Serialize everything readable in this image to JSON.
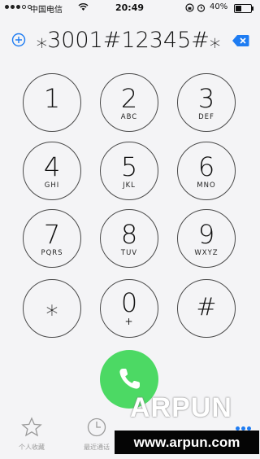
{
  "status_bar": {
    "carrier": "中国电信",
    "time": "20:49",
    "battery_percent": "40%",
    "battery_level": 0.4,
    "signal_strength": 3
  },
  "dialer": {
    "number": "⁎3001#12345#⁎"
  },
  "keypad": [
    {
      "digit": "1",
      "letters": ""
    },
    {
      "digit": "2",
      "letters": "ABC"
    },
    {
      "digit": "3",
      "letters": "DEF"
    },
    {
      "digit": "4",
      "letters": "GHI"
    },
    {
      "digit": "5",
      "letters": "JKL"
    },
    {
      "digit": "6",
      "letters": "MNO"
    },
    {
      "digit": "7",
      "letters": "PQRS"
    },
    {
      "digit": "8",
      "letters": "TUV"
    },
    {
      "digit": "9",
      "letters": "WXYZ"
    },
    {
      "digit": "⁎",
      "letters": ""
    },
    {
      "digit": "0",
      "letters": "+"
    },
    {
      "digit": "#",
      "letters": ""
    }
  ],
  "tabs": {
    "favorites": "个人收藏",
    "recents": "最近通话"
  },
  "icons": {
    "add": "add-contact-icon",
    "delete": "backspace-icon",
    "call": "phone-icon",
    "favorites": "star-icon",
    "recents": "clock-icon",
    "keypad": "keypad-dots-icon"
  },
  "colors": {
    "call_button": "#4cd964",
    "accent": "#1e7cf2"
  },
  "watermark": {
    "logo": "ARPUN",
    "url": "www.arpun.com"
  }
}
